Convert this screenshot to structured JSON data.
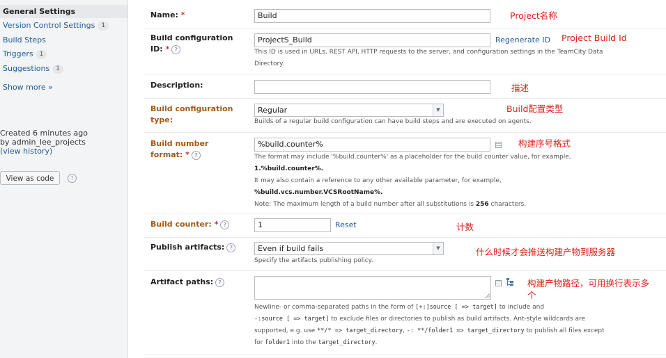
{
  "sidebar": {
    "items": [
      {
        "label": "General Settings",
        "badge": ""
      },
      {
        "label": "Version Control Settings",
        "badge": "1"
      },
      {
        "label": "Build Steps",
        "badge": ""
      },
      {
        "label": "Triggers",
        "badge": "1"
      },
      {
        "label": "Suggestions",
        "badge": "1"
      }
    ],
    "show_more": "Show more »",
    "created": "Created 6 minutes ago",
    "by": "by admin_lee_projects",
    "history": "(view history)",
    "view_as_code": "View as code"
  },
  "form": {
    "name": {
      "label": "Name:",
      "required": " *",
      "value": "Build",
      "annotation": "Project名称"
    },
    "build_id": {
      "label1": "Build configuration",
      "label2": "ID:",
      "required": " *",
      "value": "ProjectS_Build",
      "regenerate": "Regenerate ID",
      "annotation": "Project Build Id",
      "note1": "This ID is used in URLs, REST API, HTTP requests to the server, and configuration settings in the TeamCity Data",
      "note2": "Directory."
    },
    "description": {
      "label": "Description:",
      "value": "",
      "annotation": "描述"
    },
    "config_type": {
      "label1": "Build configuration",
      "label2": "type:",
      "value": "Regular",
      "annotation": "Build配置类型",
      "note": "Builds of a regular build configuration can have build steps and are executed on agents."
    },
    "number_format": {
      "label1": "Build number",
      "label2": "format:",
      "required": " *",
      "value": "%build.counter%",
      "annotation": "构建序号格式",
      "note1": "The format may include '%build.counter%' as a placeholder for the build counter value, for example,",
      "note2": "1.%build.counter%.",
      "note3": "It may also contain a reference to any other available parameter, for example,",
      "note4": "%build.vcs.number.VCSRootName%.",
      "note5_pre": "Note: The maximum length of a build number after all substitutions is ",
      "note5_num": "256",
      "note5_post": " characters."
    },
    "counter": {
      "label": "Build counter:",
      "required": " *",
      "value": "1",
      "reset": "Reset",
      "annotation": "计数"
    },
    "publish": {
      "label": "Publish artifacts:",
      "value": "Even if build fails",
      "annotation": "什么时候才会推送构建产物到服务器",
      "note": "Specify the artifacts publishing policy."
    },
    "artifacts": {
      "label": "Artifact paths:",
      "value": "",
      "annotation1": "构建产物路径，可用换行表示多",
      "annotation2": "个",
      "n1a": "Newline- or comma-separated paths in the form of ",
      "n1b": "[+:]source [ => target]",
      "n1c": " to include and",
      "n2a": "-:source [ => target]",
      "n2b": " to exclude files or directories to publish as build artifacts. Ant-style wildcards are",
      "n3a": "supported, e.g. use ",
      "n3b": "**/* => target_directory",
      "n3c": ", ",
      "n3d": "-: **/folder1 => target_directory",
      "n3e": " to publish all files except",
      "n4a": "for ",
      "n4b": "folder1",
      "n4c": " into the ",
      "n4d": "target_directory",
      "n4e": "."
    }
  },
  "colors": {
    "accent": "#1f5a9a",
    "annotation": "#e0201a",
    "label_orange": "#a25a1a"
  }
}
